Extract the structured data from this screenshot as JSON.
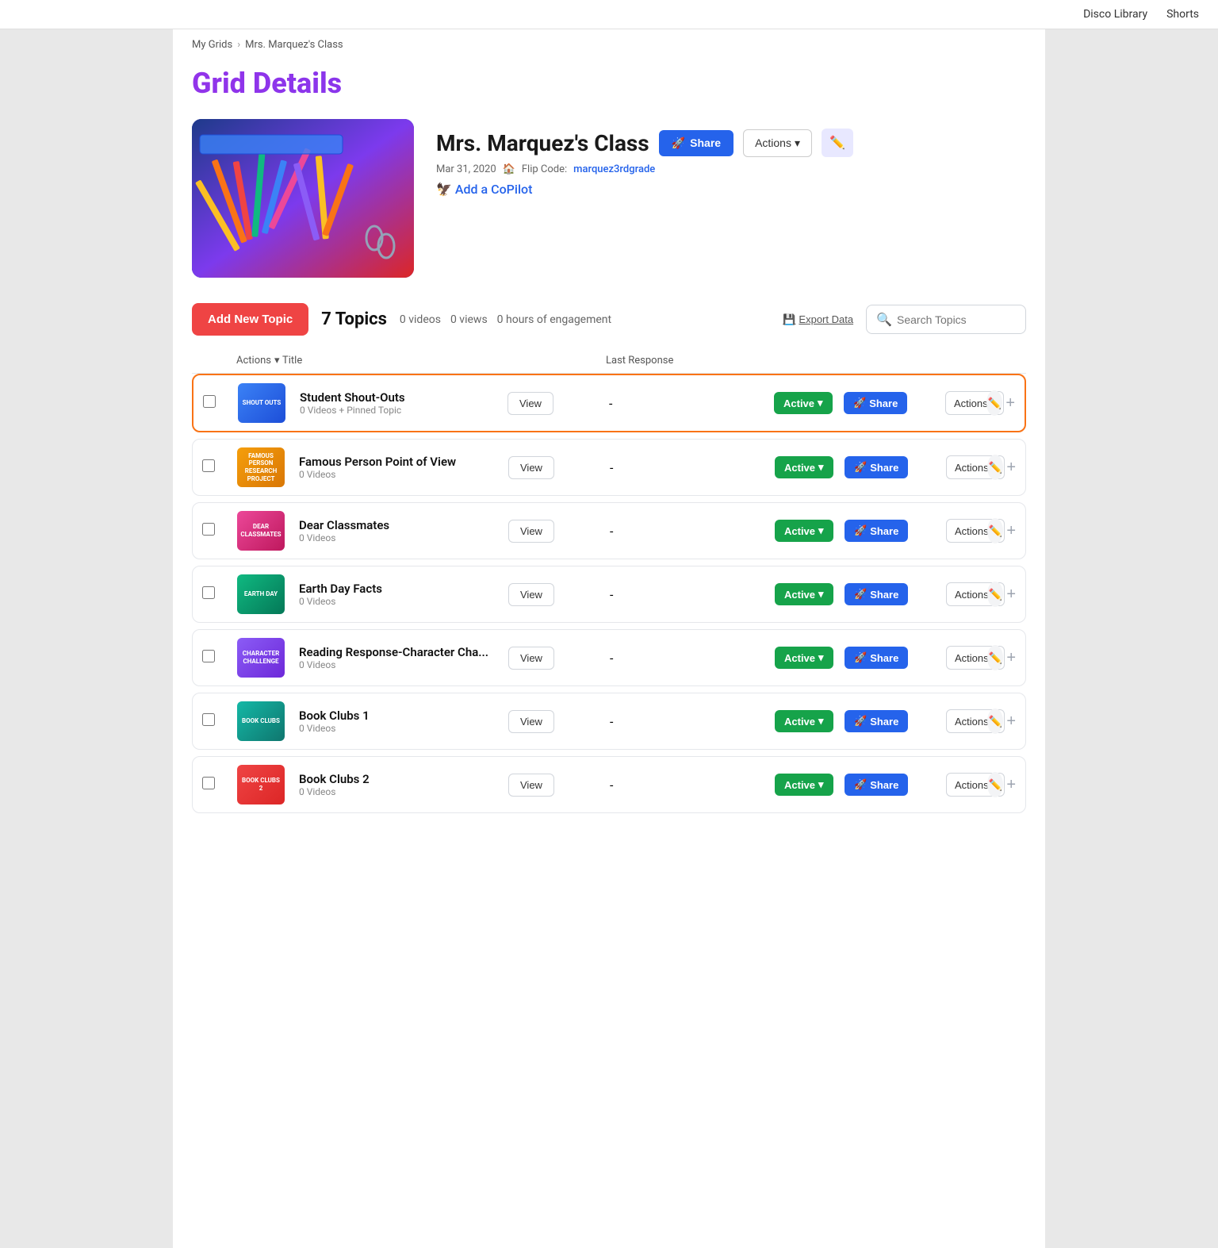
{
  "nav": {
    "links": [
      "Disco Library",
      "Shorts"
    ]
  },
  "breadcrumb": {
    "parent": "My Grids",
    "current": "Mrs. Marquez's Class"
  },
  "page": {
    "title": "Grid Details"
  },
  "grid": {
    "name": "Mrs. Marquez's Class",
    "date": "Mar 31, 2020",
    "flip_code_label": "Flip Code:",
    "flip_code": "marquez3rdgrade",
    "copilot_label": "Add a CoPilot",
    "share_label": "Share",
    "actions_label": "Actions",
    "edit_icon": "✏️"
  },
  "topics_toolbar": {
    "add_btn": "Add New Topic",
    "count_label": "7 Topics",
    "videos_label": "0 videos",
    "views_label": "0 views",
    "engagement_label": "0 hours of engagement",
    "export_label": "Export Data",
    "search_placeholder": "Search Topics"
  },
  "table": {
    "col_actions": "Actions",
    "col_title": "Title",
    "col_last_response": "Last Response"
  },
  "topics": [
    {
      "id": 1,
      "title": "Student Shout-Outs",
      "sub": "0 Videos + Pinned Topic",
      "pinned": true,
      "thumb_class": "thumb-blue",
      "thumb_text": "SHOUT OUTS",
      "highlighted": true,
      "last_response": "-",
      "status": "Active",
      "view_label": "View",
      "share_label": "Share",
      "actions_label": "Actions"
    },
    {
      "id": 2,
      "title": "Famous Person Point of View",
      "sub": "0 Videos",
      "pinned": false,
      "thumb_class": "thumb-orange",
      "thumb_text": "FAMOUS PERSON RESEARCH PROJECT",
      "highlighted": false,
      "last_response": "-",
      "status": "Active",
      "view_label": "View",
      "share_label": "Share",
      "actions_label": "Actions"
    },
    {
      "id": 3,
      "title": "Dear Classmates",
      "sub": "0 Videos",
      "pinned": false,
      "thumb_class": "thumb-pink",
      "thumb_text": "DEAR CLASSMATES",
      "highlighted": false,
      "last_response": "-",
      "status": "Active",
      "view_label": "View",
      "share_label": "Share",
      "actions_label": "Actions"
    },
    {
      "id": 4,
      "title": "Earth Day Facts",
      "sub": "0 Videos",
      "pinned": false,
      "thumb_class": "thumb-green",
      "thumb_text": "EARTH DAY",
      "highlighted": false,
      "last_response": "-",
      "status": "Active",
      "view_label": "View",
      "share_label": "Share",
      "actions_label": "Actions"
    },
    {
      "id": 5,
      "title": "Reading Response-Character Cha...",
      "sub": "0 Videos",
      "pinned": false,
      "thumb_class": "thumb-purple",
      "thumb_text": "CHARACTER CHALLENGE",
      "highlighted": false,
      "last_response": "-",
      "status": "Active",
      "view_label": "View",
      "share_label": "Share",
      "actions_label": "Actions"
    },
    {
      "id": 6,
      "title": "Book Clubs 1",
      "sub": "0 Videos",
      "pinned": false,
      "thumb_class": "thumb-teal",
      "thumb_text": "BOOK CLUBS",
      "highlighted": false,
      "last_response": "-",
      "status": "Active",
      "view_label": "View",
      "share_label": "Share",
      "actions_label": "Actions"
    },
    {
      "id": 7,
      "title": "Book Clubs 2",
      "sub": "0 Videos",
      "pinned": false,
      "thumb_class": "thumb-red",
      "thumb_text": "BOOK CLUBS 2",
      "highlighted": false,
      "last_response": "-",
      "status": "Active",
      "view_label": "View",
      "share_label": "Share",
      "actions_label": "Actions"
    }
  ]
}
